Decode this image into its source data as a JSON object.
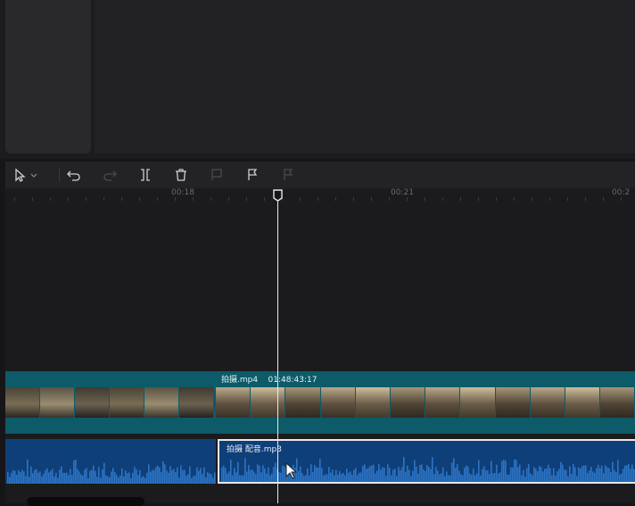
{
  "toolbar": {
    "tools": [
      {
        "name": "select-tool",
        "icon": "pointer-icon"
      },
      {
        "name": "undo",
        "icon": "undo-icon"
      },
      {
        "name": "redo",
        "icon": "redo-icon"
      },
      {
        "name": "split",
        "icon": "split-icon"
      },
      {
        "name": "delete",
        "icon": "trash-icon"
      },
      {
        "name": "freeze",
        "icon": "freeze-icon"
      },
      {
        "name": "marker",
        "icon": "flag-icon"
      },
      {
        "name": "marker-disabled",
        "icon": "flag-icon"
      }
    ]
  },
  "ruler": {
    "ticks": [
      "00:18",
      "00:21",
      "00:2"
    ]
  },
  "video_track": {
    "clip_name": "拍摄.mp4",
    "clip_duration": "01:48:43:17"
  },
  "audio_track": {
    "clip_name": "拍摄  配音.mp3"
  },
  "colors": {
    "video_track": "#0d5a68",
    "audio_clip": "#0f3f78",
    "waveform": "#2c74c4",
    "playhead": "#e8e8ea"
  }
}
